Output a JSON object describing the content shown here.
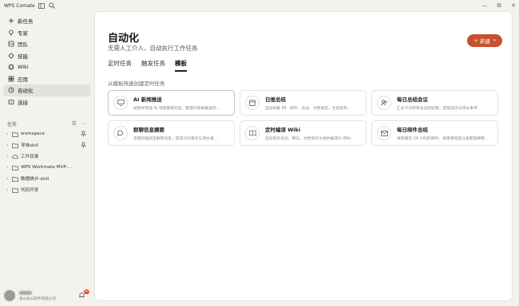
{
  "titlebar": {
    "app_name": "WPS Comate",
    "controls": [
      "—",
      "⧉",
      "✕"
    ]
  },
  "sidebar": {
    "nav": [
      {
        "label": "新任务",
        "icon": "plus-icon"
      },
      {
        "label": "专家",
        "icon": "bulb-icon"
      },
      {
        "label": "团队",
        "icon": "team-icon"
      },
      {
        "label": "技能",
        "icon": "skill-icon"
      },
      {
        "label": "Wiki",
        "icon": "globe-icon"
      },
      {
        "label": "应用",
        "icon": "apps-icon"
      },
      {
        "label": "自动化",
        "icon": "clock-icon"
      },
      {
        "label": "连接",
        "icon": "link-icon"
      }
    ],
    "tasks_header": "任务",
    "tasks": [
      {
        "label": "workspace",
        "pinned": true
      },
      {
        "label": "寻味skill",
        "pinned": true
      },
      {
        "label": "工作目录",
        "pinned": false
      },
      {
        "label": "WPS Workmate MVP-…",
        "pinned": false
      },
      {
        "label": "数据统计-skill",
        "pinned": false
      },
      {
        "label": "代码开发",
        "pinned": false
      }
    ],
    "user": {
      "org": "金山办公软件有限公司",
      "notifications": "99"
    }
  },
  "main": {
    "title": "自动化",
    "subtitle": "无需人工介入，自动执行工作任务",
    "new_button": "新建",
    "tabs": [
      "定时任务",
      "触发任务",
      "模板"
    ],
    "active_tab": "模板",
    "hint": "从模板快速创建定时任务",
    "templates": [
      {
        "title": "AI 新闻推送",
        "desc": "搜索并筛选 AI 领域重要动态，整理为简报推送到…",
        "icon": "monitor-icon"
      },
      {
        "title": "日报总结",
        "desc": "自动采集 IM、邮件、会议、文档动态，生成结构…",
        "icon": "calendar-icon"
      },
      {
        "title": "每日总结会议",
        "desc": "汇总今日所有会议的纪要，提炼成近与待办事项",
        "icon": "people-icon"
      },
      {
        "title": "群聊信息摘要",
        "desc": "定期扫描指定群聊消息，提炼讨论要点与待办事…",
        "icon": "chat-icon"
      },
      {
        "title": "定时编译 Wiki",
        "desc": "自动同步会议、聊天、文档到云文档并编译为 Wiki",
        "icon": "book-icon"
      },
      {
        "title": "每日邮件总结",
        "desc": "搜索最近 24 小时的邮件，按重要程度分类整理摘要…",
        "icon": "mail-icon"
      }
    ]
  },
  "colors": {
    "accent": "#c8502f",
    "background": "#f3f2ee",
    "panel": "#ffffff"
  }
}
